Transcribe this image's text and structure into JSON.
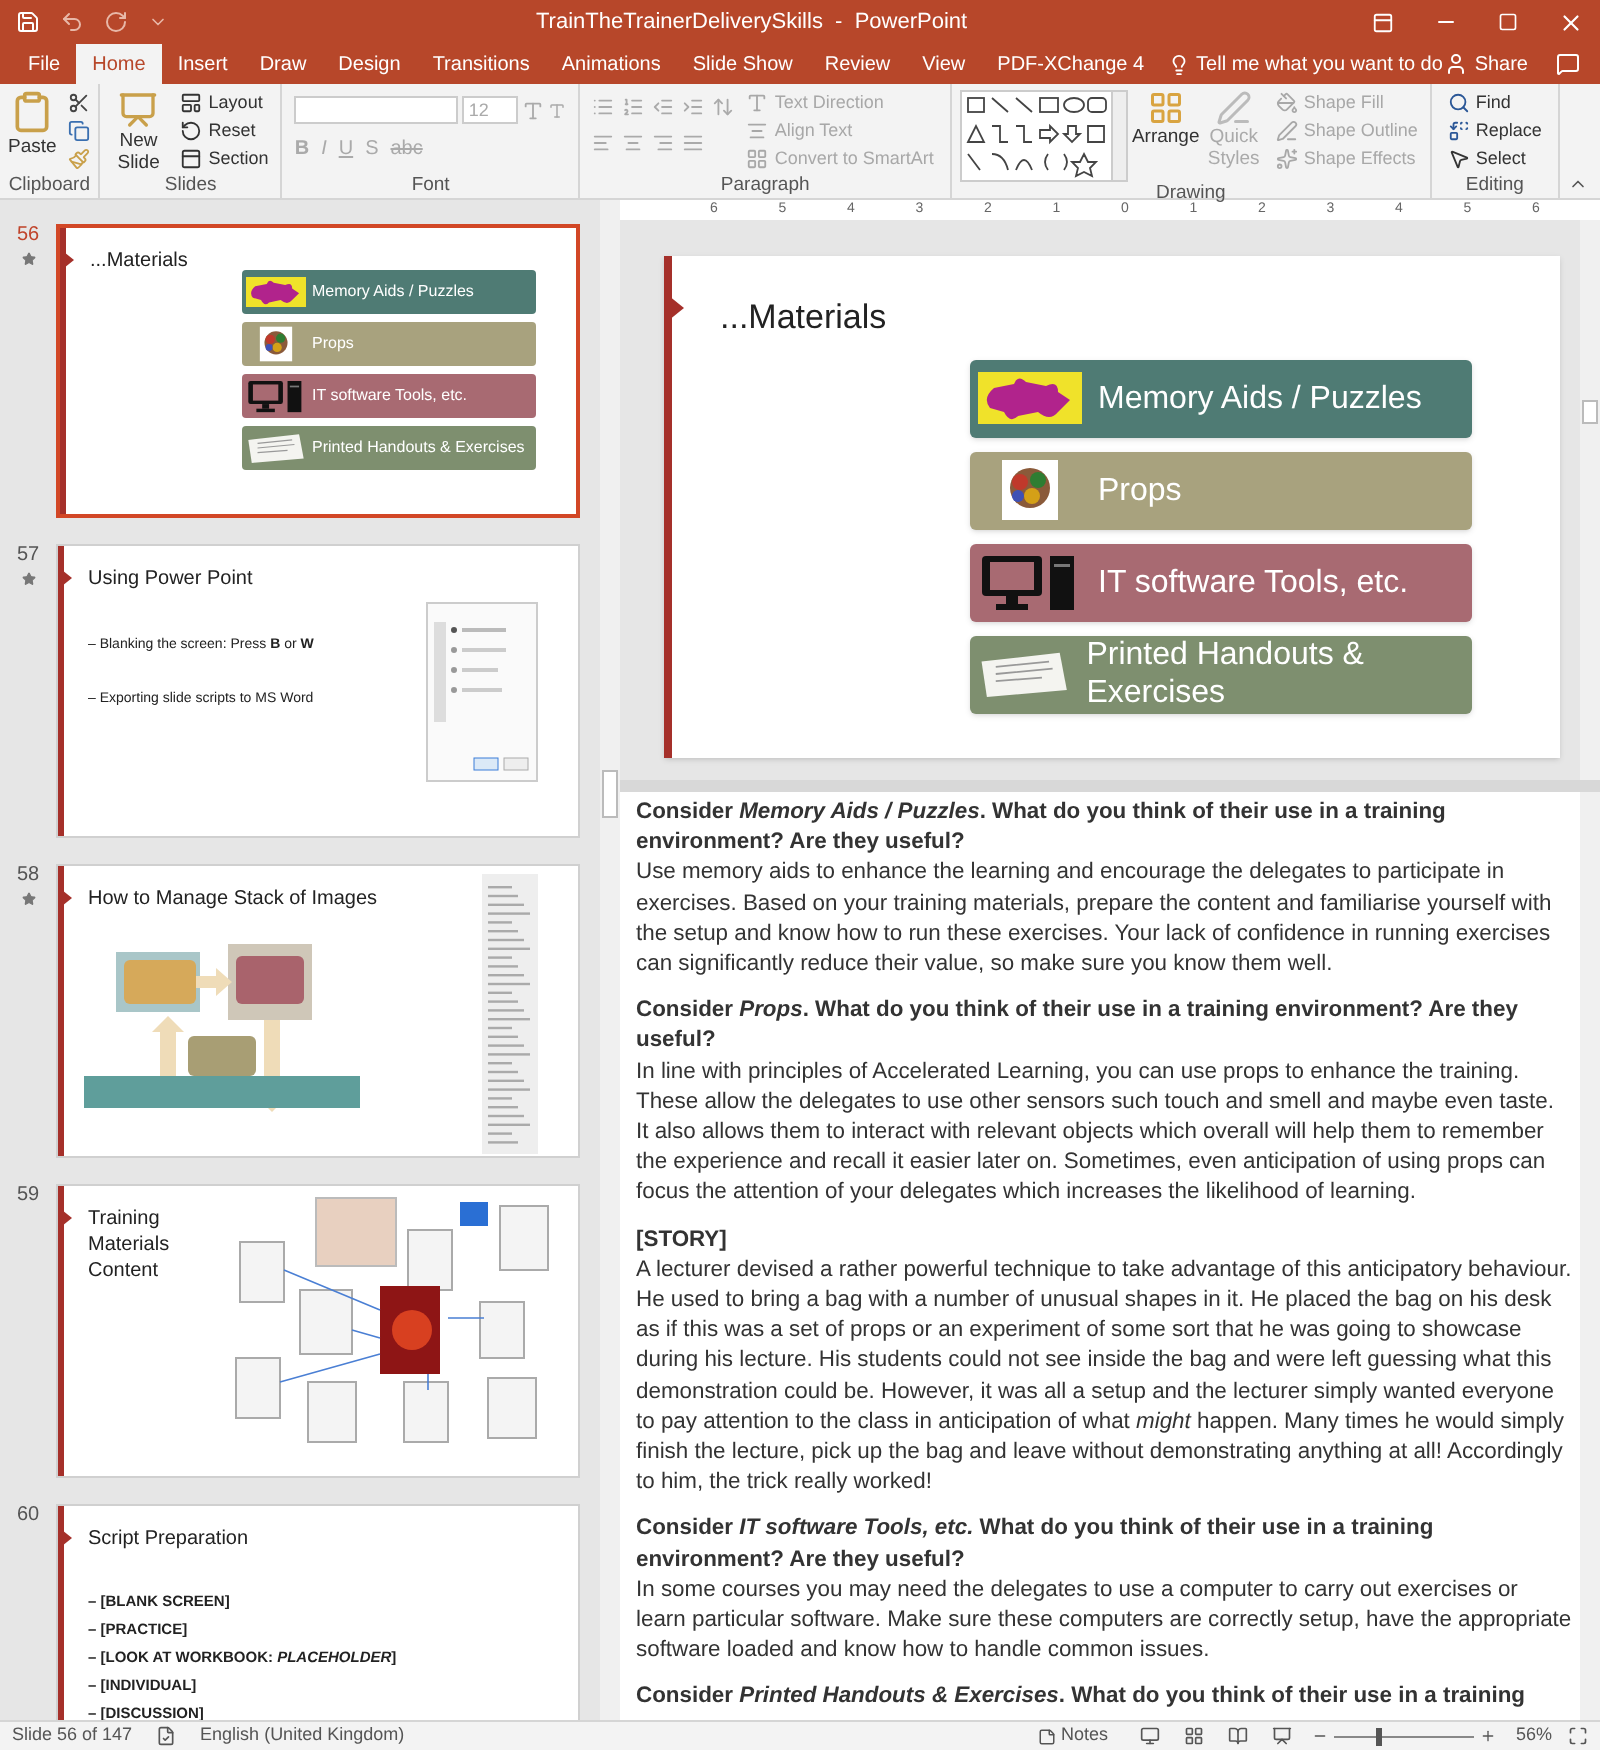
{
  "window": {
    "title": "TrainTheTrainerDeliverySkills  -  PowerPoint"
  },
  "tabs": [
    {
      "label": "File",
      "selected": false
    },
    {
      "label": "Home",
      "selected": true
    },
    {
      "label": "Insert",
      "selected": false
    },
    {
      "label": "Draw",
      "selected": false
    },
    {
      "label": "Design",
      "selected": false
    },
    {
      "label": "Transitions",
      "selected": false
    },
    {
      "label": "Animations",
      "selected": false
    },
    {
      "label": "Slide Show",
      "selected": false
    },
    {
      "label": "Review",
      "selected": false
    },
    {
      "label": "View",
      "selected": false
    },
    {
      "label": "PDF-XChange 4",
      "selected": false
    }
  ],
  "tell_me": "Tell me what you want to do",
  "share": "Share",
  "ribbon": {
    "groups": [
      {
        "kind": "clipboard",
        "label": "Clipboard",
        "large": [
          {
            "label": "Paste",
            "disabled": false
          }
        ]
      },
      {
        "kind": "slides",
        "label": "Slides",
        "large": [
          {
            "label": "New Slide",
            "disabled": false
          }
        ],
        "small": [
          {
            "label": "Layout",
            "disabled": false
          },
          {
            "label": "Reset",
            "disabled": false
          },
          {
            "label": "Section",
            "disabled": false
          }
        ]
      },
      {
        "kind": "font",
        "label": "Font",
        "size": "12",
        "format": [
          "B",
          "I",
          "U",
          "S",
          "abc"
        ]
      },
      {
        "kind": "paragraph",
        "label": "Paragraph",
        "small": [
          {
            "label": "Text Direction",
            "disabled": true
          },
          {
            "label": "Align Text",
            "disabled": true
          },
          {
            "label": "Convert to SmartArt",
            "disabled": true
          }
        ]
      },
      {
        "kind": "drawing",
        "label": "Drawing",
        "large": [
          {
            "label": "Arrange",
            "disabled": false
          },
          {
            "label": "Quick Styles",
            "disabled": true
          }
        ],
        "small": [
          {
            "label": "Shape Fill",
            "disabled": true
          },
          {
            "label": "Shape Outline",
            "disabled": true
          },
          {
            "label": "Shape Effects",
            "disabled": true
          }
        ]
      },
      {
        "kind": "editing",
        "label": "Editing",
        "small": [
          {
            "label": "Find",
            "disabled": false
          },
          {
            "label": "Replace",
            "disabled": false
          },
          {
            "label": "Select",
            "disabled": false
          }
        ]
      }
    ]
  },
  "slides": [
    {
      "number": "56",
      "starred": true,
      "selected": true,
      "kind": "materials",
      "title": "...Materials",
      "items": [
        {
          "label": "Memory Aids / Puzzles",
          "kind": "puzzle",
          "color": "#4f7b74"
        },
        {
          "label": "Props",
          "kind": "props",
          "color": "#a8a27e"
        },
        {
          "label": "IT software Tools, etc.",
          "kind": "computer",
          "color": "#a86a72"
        },
        {
          "label": "Printed Handouts & Exercises",
          "kind": "handout",
          "color": "#7e8f6f"
        }
      ]
    },
    {
      "number": "57",
      "starred": true,
      "selected": false,
      "kind": "bullets",
      "title": "Using Power Point",
      "bullets": [
        "– Blanking the screen: Press **B** or **W**",
        "– Exporting slide scripts to MS Word"
      ]
    },
    {
      "number": "58",
      "starred": true,
      "selected": false,
      "kind": "diagram",
      "title": "How to Manage Stack of Images"
    },
    {
      "number": "59",
      "starred": false,
      "selected": false,
      "kind": "collage",
      "title": "Training Materials Content"
    },
    {
      "number": "60",
      "starred": false,
      "selected": false,
      "kind": "script",
      "title": "Script Preparation",
      "bullets": [
        "– [BLANK SCREEN]",
        "– [PRACTICE]",
        "– [LOOK AT WORKBOOK: *PLACEHOLDER*]",
        "– [INDIVIDUAL]",
        "– [DISCUSSION]"
      ]
    }
  ],
  "ruler": {
    "labels": [
      "6",
      "5",
      "4",
      "3",
      "2",
      "1",
      "0",
      "1",
      "2",
      "3",
      "4",
      "5",
      "6"
    ]
  },
  "current_slide": {
    "title": "...Materials",
    "items": [
      {
        "label": "Memory Aids / Puzzles",
        "kind": "puzzle",
        "color": "#4f7b74"
      },
      {
        "label": "Props",
        "kind": "props",
        "color": "#a8a27e"
      },
      {
        "label": "IT software Tools, etc.",
        "kind": "computer",
        "color": "#a86a72"
      },
      {
        "label": "Printed Handouts & Exercises",
        "kind": "handout",
        "color": "#7e8f6f"
      }
    ]
  },
  "notes": [
    {
      "kind": "question",
      "text": "Consider *Memory Aids / Puzzles*. What do you think of their use in a training environment? Are they useful?"
    },
    {
      "kind": "body",
      "text": "Use memory aids to enhance the learning and encourage the delegates to participate in exercises. Based on your training materials, prepare the content and familiarise yourself with the setup and know how to run these exercises. Your lack of confidence in running exercises can significantly reduce their value, so make sure you know them well."
    },
    {
      "kind": "question",
      "text": "Consider *Props*. What do you think of their use in a training environment? Are they useful?"
    },
    {
      "kind": "body",
      "text": "In line with principles of Accelerated Learning, you can use props to enhance the training. These allow the delegates to use other sensors such touch and smell and maybe even taste. It also allows them to interact with relevant objects which overall will help them to remember the experience and recall it easier later on. Sometimes, even anticipation of using props can focus the attention of your delegates which increases the likelihood of learning."
    },
    {
      "kind": "question",
      "text": "[STORY]"
    },
    {
      "kind": "body",
      "text": "A lecturer devised a rather powerful technique to take advantage of this anticipatory behaviour. He used to bring a bag with a number of unusual shapes in it. He placed the bag on his desk as if this was a set of props or an experiment of some sort that he was going to showcase during his lecture. His students could not see inside the bag and were left guessing what this demonstration could be. However, it was all a setup and the lecturer simply wanted everyone to pay attention to the class in anticipation of what *might* happen. Many times he would simply finish the lecture, pick up the bag and leave without demonstrating anything at all! Accordingly to him, the trick really worked!"
    },
    {
      "kind": "question",
      "text": "Consider *IT software Tools, etc.* What do you think of their use in a training environment? Are they useful?"
    },
    {
      "kind": "body",
      "text": "In some courses you may need the delegates to use a computer to carry out exercises or learn particular software. Make sure these computers are correctly setup, have the appropriate software loaded and know how to handle common issues."
    },
    {
      "kind": "question",
      "text": "Consider *Printed Handouts & Exercises*. What do you think of their use in a training"
    }
  ],
  "status": {
    "slide": "Slide 56 of 147",
    "language": "English (United Kingdom)",
    "notes": "Notes",
    "zoom": "56%",
    "zoom_slider": {
      "level": 0.31
    }
  }
}
